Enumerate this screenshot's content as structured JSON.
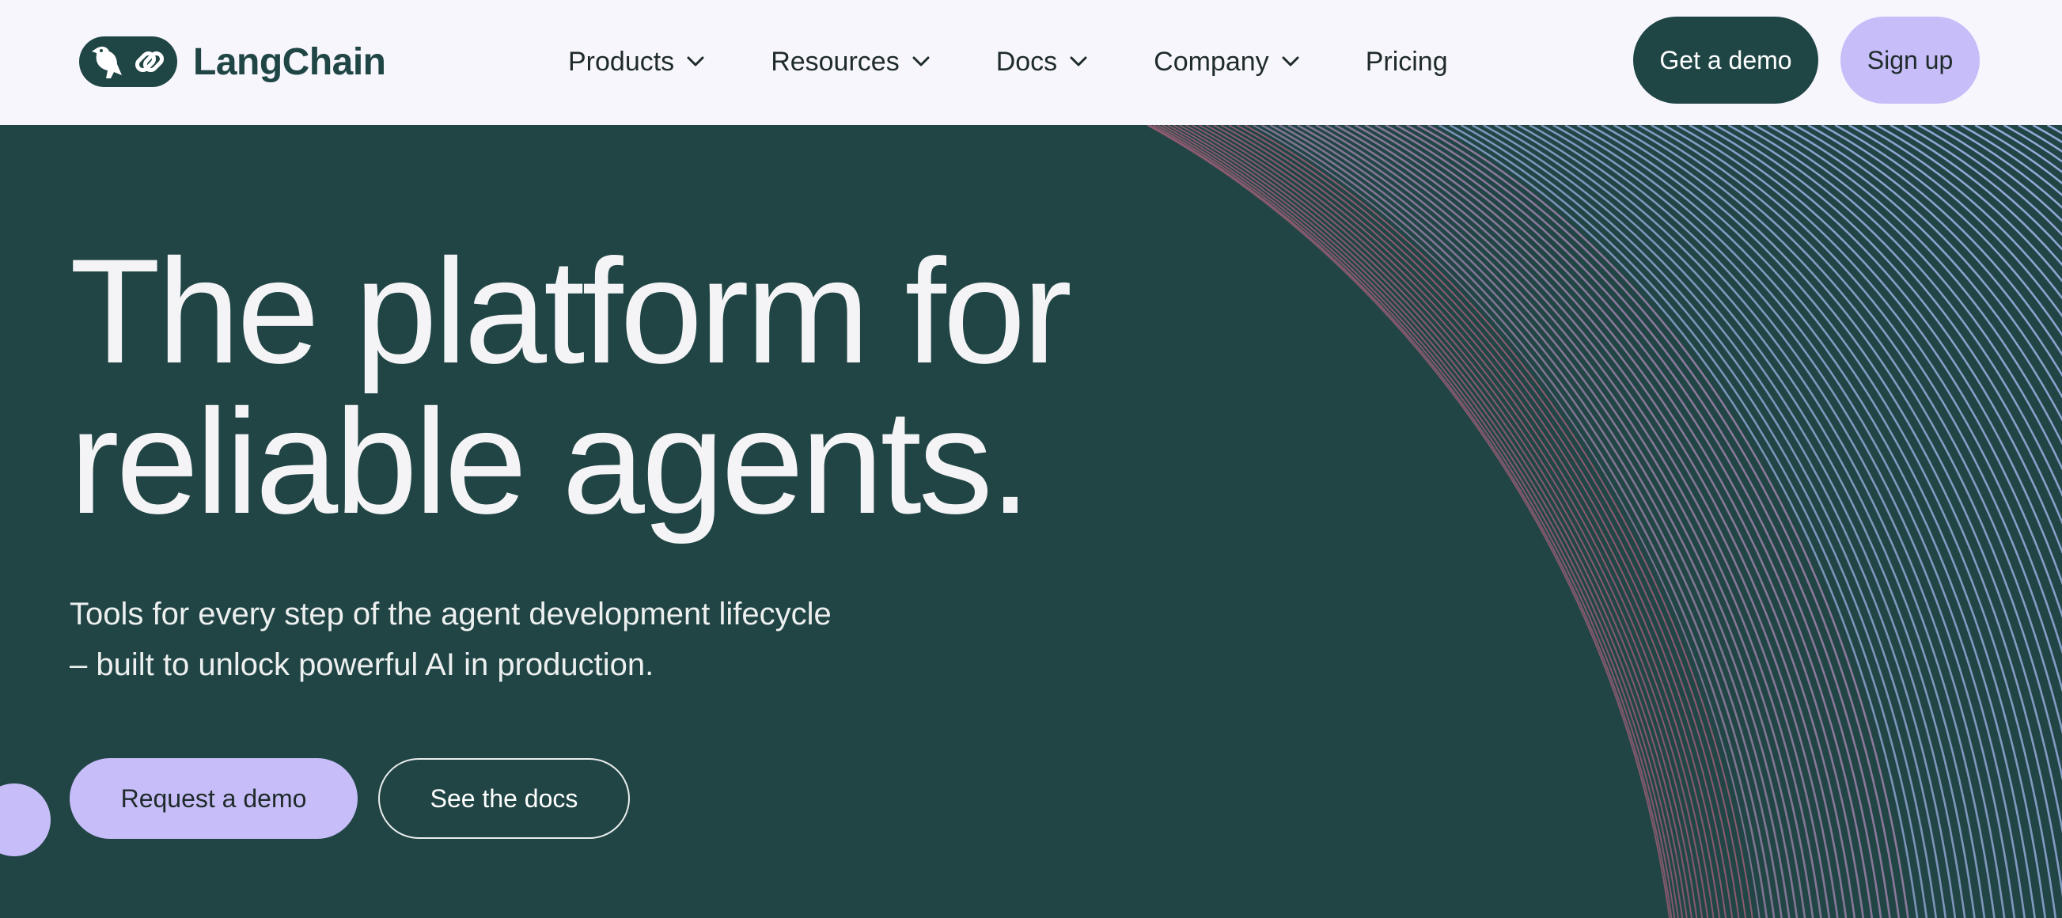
{
  "brand": {
    "name": "LangChain",
    "icons": [
      "parrot-icon",
      "chain-link-icon"
    ]
  },
  "nav": {
    "items": [
      {
        "label": "Products",
        "has_dropdown": true
      },
      {
        "label": "Resources",
        "has_dropdown": true
      },
      {
        "label": "Docs",
        "has_dropdown": true
      },
      {
        "label": "Company",
        "has_dropdown": true
      },
      {
        "label": "Pricing",
        "has_dropdown": false
      }
    ],
    "get_demo_label": "Get a demo",
    "sign_up_label": "Sign up"
  },
  "hero": {
    "title_line1": "The platform for",
    "title_line2": "reliable agents.",
    "subtitle_line1": "Tools for every step of the agent development lifecycle",
    "subtitle_line2": "– built to unlock powerful AI in production.",
    "primary_cta": "Request a demo",
    "secondary_cta": "See the docs"
  },
  "colors": {
    "nav_background": "#f7f6fd",
    "hero_background": "#214545",
    "brand_dark": "#1f4545",
    "accent_lavender": "#c7bdf8",
    "line_pink": "#d06a8c",
    "line_blue": "#9fb3e6"
  }
}
